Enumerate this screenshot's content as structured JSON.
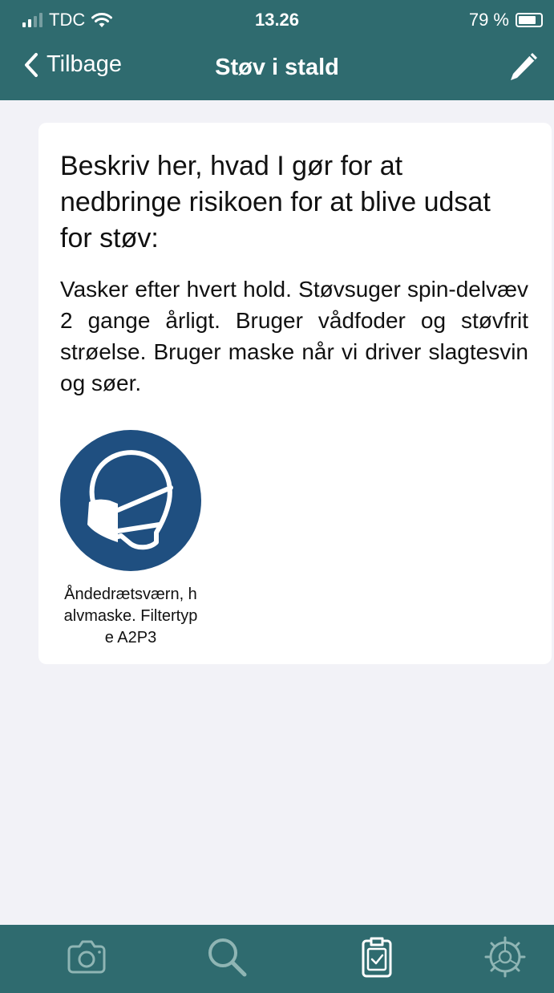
{
  "status_bar": {
    "carrier": "TDC",
    "time": "13.26",
    "battery": "79 %",
    "battery_level": 0.79
  },
  "nav": {
    "back_label": "Tilbage",
    "title": "Støv i stald"
  },
  "card": {
    "heading": "Beskriv her, hvad I gør for at nedbringe risikoen for at blive udsat for støv:",
    "body": "Vasker efter hvert hold. Støvsuger spin-delvæv 2 gange årligt. Bruger vådfoder og støvfrit strøelse. Bruger maske når vi driver slagtesvin og søer.",
    "ppe_caption": "Åndedrætsværn, halvmaske. Filtertype A2P3"
  },
  "tabs": [
    {
      "icon": "camera-icon",
      "selected": false
    },
    {
      "icon": "search-icon",
      "selected": false
    },
    {
      "icon": "clipboard-check-icon",
      "selected": true
    },
    {
      "icon": "settings-icon",
      "selected": false
    }
  ],
  "colors": {
    "header": "#2f6b6f",
    "background": "#f2f2f7",
    "ppe_blue": "#1f4f80"
  }
}
